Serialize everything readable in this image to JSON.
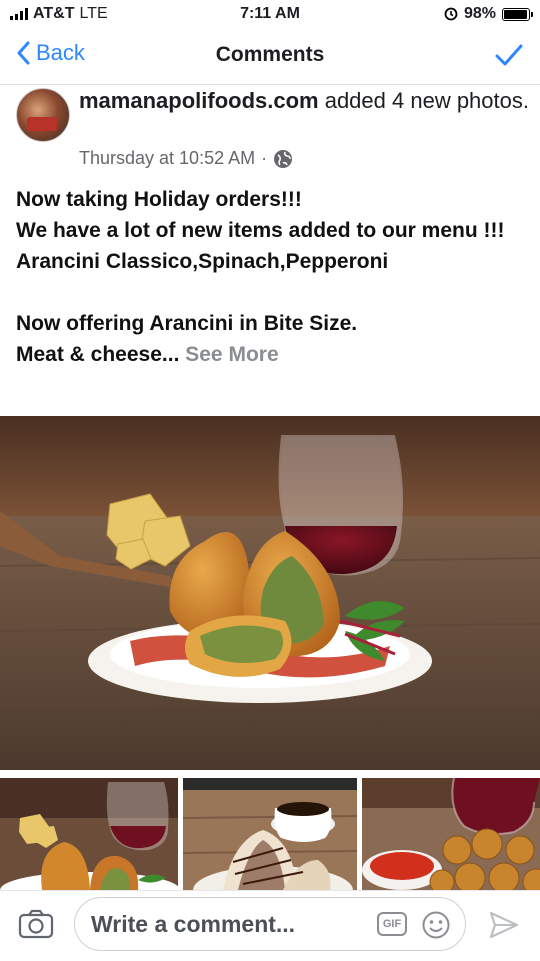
{
  "status_bar": {
    "carrier": "AT&T",
    "network": "LTE",
    "time": "7:11 AM",
    "battery": "98%",
    "battery_level": 0.98
  },
  "navbar": {
    "back_label": "Back",
    "title": "Comments"
  },
  "post": {
    "author": "mamanapolifoods.com",
    "action": " added 4 new photos.",
    "timestamp": "Thursday at 10:52 AM",
    "separator": "·",
    "body_lines": [
      "Now taking Holiday orders!!!",
      "We have a lot of new items added to our menu !!!",
      "Arancini Classico,Spinach,Pepperoni",
      "",
      "Now offering Arancini in  Bite Size."
    ],
    "last_line": "Meat & cheese... ",
    "see_more": "See More"
  },
  "composer": {
    "placeholder": "Write a comment...",
    "gif_label": "GIF"
  },
  "icons": [
    "signal-icon",
    "alarm-icon",
    "battery-icon",
    "back-chevron-icon",
    "checkmark-icon",
    "globe-icon",
    "camera-icon",
    "gif-icon",
    "emoji-icon",
    "send-icon"
  ],
  "colors": {
    "accent": "#2d88ff",
    "muted": "#65676b"
  }
}
